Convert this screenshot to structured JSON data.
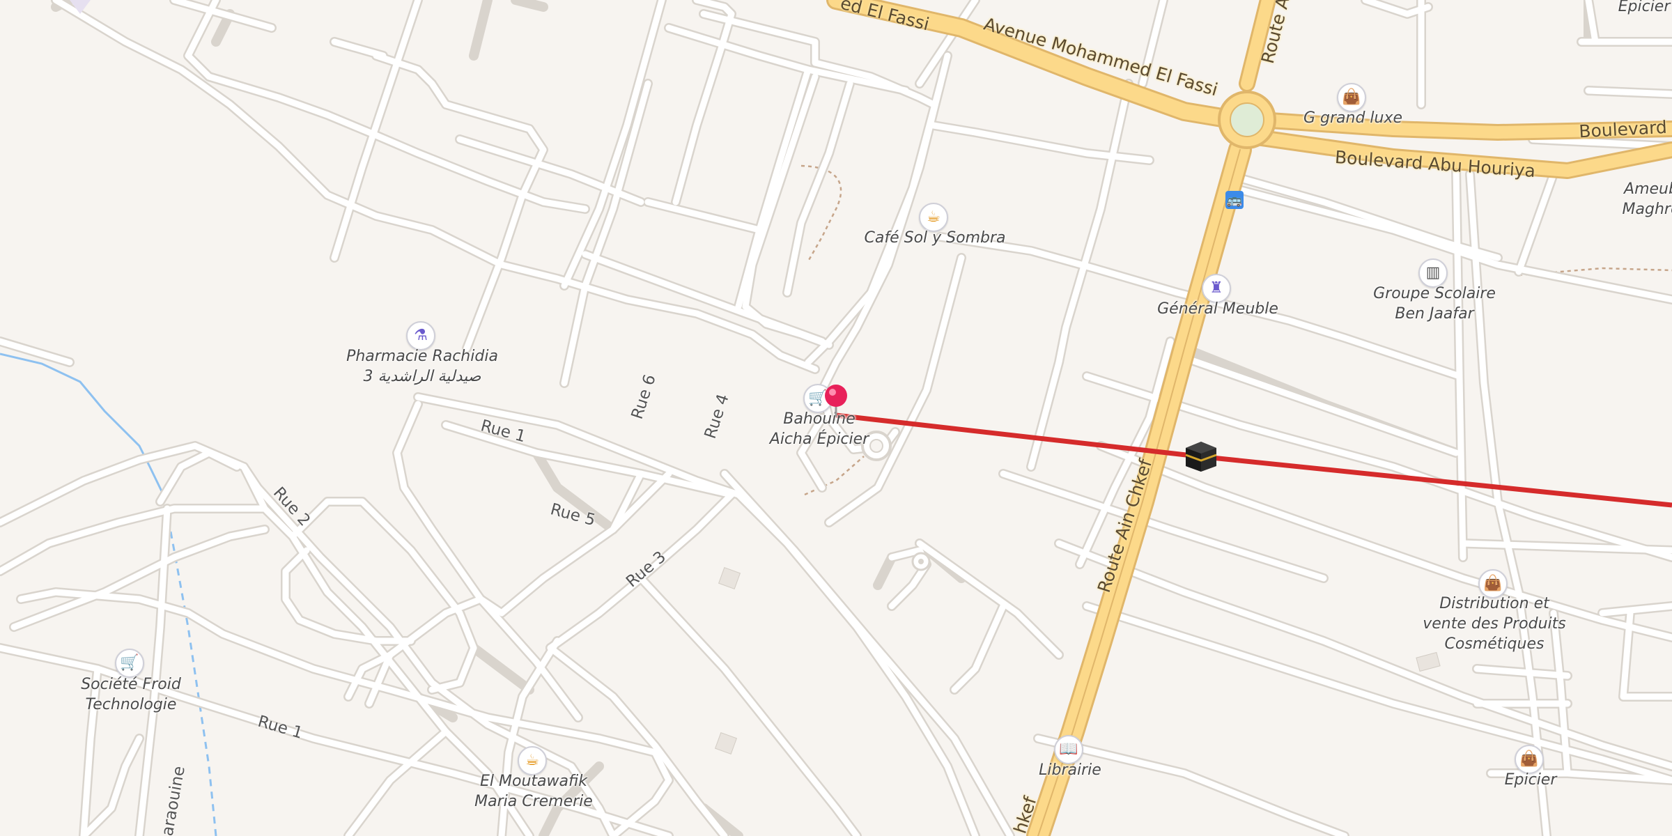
{
  "map": {
    "colors": {
      "background": "#f7f4f0",
      "street": "#ffffff",
      "street_casing": "#d9d4cd",
      "major_road": "#fcd98a",
      "major_casing": "#e0b66a",
      "route_line": "#d52b2b",
      "water": "#8ec1f0",
      "path": "#c6a58a"
    },
    "street_labels": [
      "Rue 1",
      "Rue 5",
      "Rue 6",
      "Rue 4",
      "Rue 2",
      "Rue 3",
      "Rue 1",
      "araouine"
    ],
    "major_labels": [
      "Avenue Mohammed El Fassi",
      "ed El Fassi",
      "Route Ain Chkef",
      "Boulevard Abu Houriya",
      "Boulevard Ab",
      "Route Ai",
      "hkef"
    ],
    "pois": [
      {
        "name": "Café Sol y Sombra",
        "icon": "cafe-icon"
      },
      {
        "name": "Pharmacie Rachidia",
        "name2": "3 صيدلية الراشدية",
        "icon": "pharmacy-icon"
      },
      {
        "name": "Bahouine",
        "name2": "Aicha Épicier",
        "icon": "shopping-cart-icon"
      },
      {
        "name": "Général Meuble",
        "icon": "lamp-icon"
      },
      {
        "name": "Groupe Scolaire",
        "name2": "Ben Jaafar",
        "icon": "school-icon"
      },
      {
        "name": "G grand luxe",
        "icon": "shop-icon"
      },
      {
        "name": "Distribution et",
        "name2": "vente des Produits",
        "name3": "Cosmétiques",
        "icon": "shop-icon"
      },
      {
        "name": "Société Froid",
        "name2": "Technologie",
        "icon": "shopping-cart-icon"
      },
      {
        "name": "El Moutawafik",
        "name2": "Maria Cremerie",
        "icon": "cafe-icon"
      },
      {
        "name": "Librairie",
        "icon": "book-icon"
      },
      {
        "name": "Epicier",
        "icon": "shop-icon"
      },
      {
        "name": "Ameub",
        "name2": "Maghre"
      },
      {
        "name": "Epicier"
      }
    ],
    "icons": {
      "bus_stop": "bus-stop-icon",
      "destination_pin": "location-pin-icon",
      "qibla_marker": "kaaba-icon"
    }
  }
}
